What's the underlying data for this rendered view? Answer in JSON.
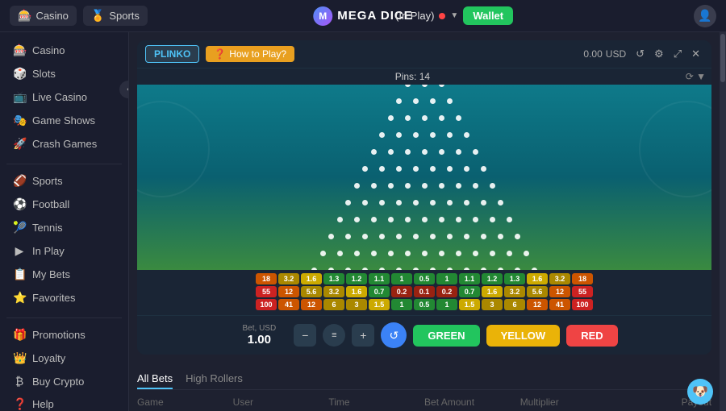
{
  "topnav": {
    "casino_label": "Casino",
    "sports_label": "Sports",
    "logo_text": "MEGA DICE",
    "in_play_label": "(In Play)",
    "wallet_label": "Wallet"
  },
  "sidebar": {
    "items": [
      {
        "id": "casino",
        "label": "Casino",
        "icon": "🎰"
      },
      {
        "id": "slots",
        "label": "Slots",
        "icon": "🎲"
      },
      {
        "id": "live-casino",
        "label": "Live Casino",
        "icon": "🎥"
      },
      {
        "id": "game-shows",
        "label": "Game Shows",
        "icon": "🎭"
      },
      {
        "id": "crash-games",
        "label": "Crash Games",
        "icon": "🚀"
      },
      {
        "id": "sports",
        "label": "Sports",
        "icon": "🏈"
      },
      {
        "id": "football",
        "label": "Football",
        "icon": "⚽"
      },
      {
        "id": "tennis",
        "label": "Tennis",
        "icon": "🎾"
      },
      {
        "id": "in-play",
        "label": "In Play",
        "icon": "▶"
      },
      {
        "id": "my-bets",
        "label": "My Bets",
        "icon": "📋"
      },
      {
        "id": "favorites",
        "label": "Favorites",
        "icon": "⭐"
      },
      {
        "id": "promotions",
        "label": "Promotions",
        "icon": "🎁"
      },
      {
        "id": "loyalty",
        "label": "Loyalty",
        "icon": "👑"
      },
      {
        "id": "buy-crypto",
        "label": "Buy Crypto",
        "icon": "₿"
      },
      {
        "id": "help",
        "label": "Help",
        "icon": "❓"
      }
    ]
  },
  "game": {
    "title": "PLINKO",
    "how_to_play": "How to Play?",
    "pins_label": "Pins: 14",
    "balance": "0.00",
    "currency": "USD",
    "bet_label": "Bet, USD",
    "bet_value": "1.00",
    "btn_green": "GREEN",
    "btn_yellow": "YELLOW",
    "btn_red": "RED"
  },
  "multipliers": {
    "row1": [
      "18",
      "3.2",
      "1.6",
      "1.3",
      "1.2",
      "1.1",
      "1",
      "0.5",
      "1",
      "1.1",
      "1.2",
      "1.3",
      "1.6",
      "3.2",
      "18"
    ],
    "row2": [
      "55",
      "12",
      "5.6",
      "3.2",
      "1.6",
      "0.7",
      "0.2",
      "0.1",
      "0.2",
      "0.7",
      "1.6",
      "3.2",
      "5.6",
      "12",
      "55"
    ],
    "row3": [
      "100",
      "41",
      "12",
      "6",
      "3",
      "1.5",
      "1",
      "0.5",
      "1",
      "1.5",
      "3",
      "6",
      "12",
      "41",
      "100"
    ]
  },
  "bottom_tabs": {
    "all_bets": "All Bets",
    "high_rollers": "High Rollers"
  },
  "table_headers": {
    "game": "Game",
    "user": "User",
    "time": "Time",
    "bet_amount": "Bet Amount",
    "multiplier": "Multiplier",
    "payout": "Payout"
  }
}
